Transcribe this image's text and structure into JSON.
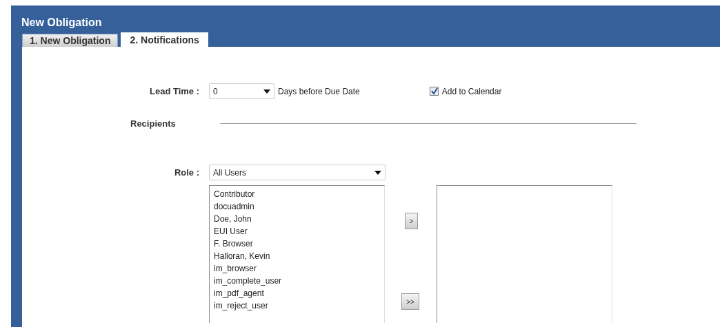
{
  "window": {
    "title": "New Obligation"
  },
  "tabs": [
    {
      "label": "1. New Obligation",
      "selected": false
    },
    {
      "label": "2. Notifications",
      "selected": true
    }
  ],
  "lead_time": {
    "label": "Lead Time :",
    "value": "0",
    "suffix": "Days before Due Date"
  },
  "add_to_calendar": {
    "label": "Add to Calendar",
    "checked": true
  },
  "recipients": {
    "label": "Recipients"
  },
  "role": {
    "label": "Role :",
    "value": "All Users"
  },
  "available_users": [
    {
      "label": "Contributor",
      "selected": false
    },
    {
      "label": "docuadmin",
      "selected": false
    },
    {
      "label": "Doe, John",
      "selected": false
    },
    {
      "label": "EUI User",
      "selected": false
    },
    {
      "label": "F. Browser",
      "selected": false
    },
    {
      "label": "Halloran, Kevin",
      "selected": false
    },
    {
      "label": "im_browser",
      "selected": false
    },
    {
      "label": "im_complete_user",
      "selected": false
    },
    {
      "label": "im_pdf_agent",
      "selected": false
    },
    {
      "label": "im_reject_user",
      "selected": false
    }
  ],
  "move_buttons": [
    {
      "label": ">"
    },
    {
      "label": ">>"
    }
  ]
}
